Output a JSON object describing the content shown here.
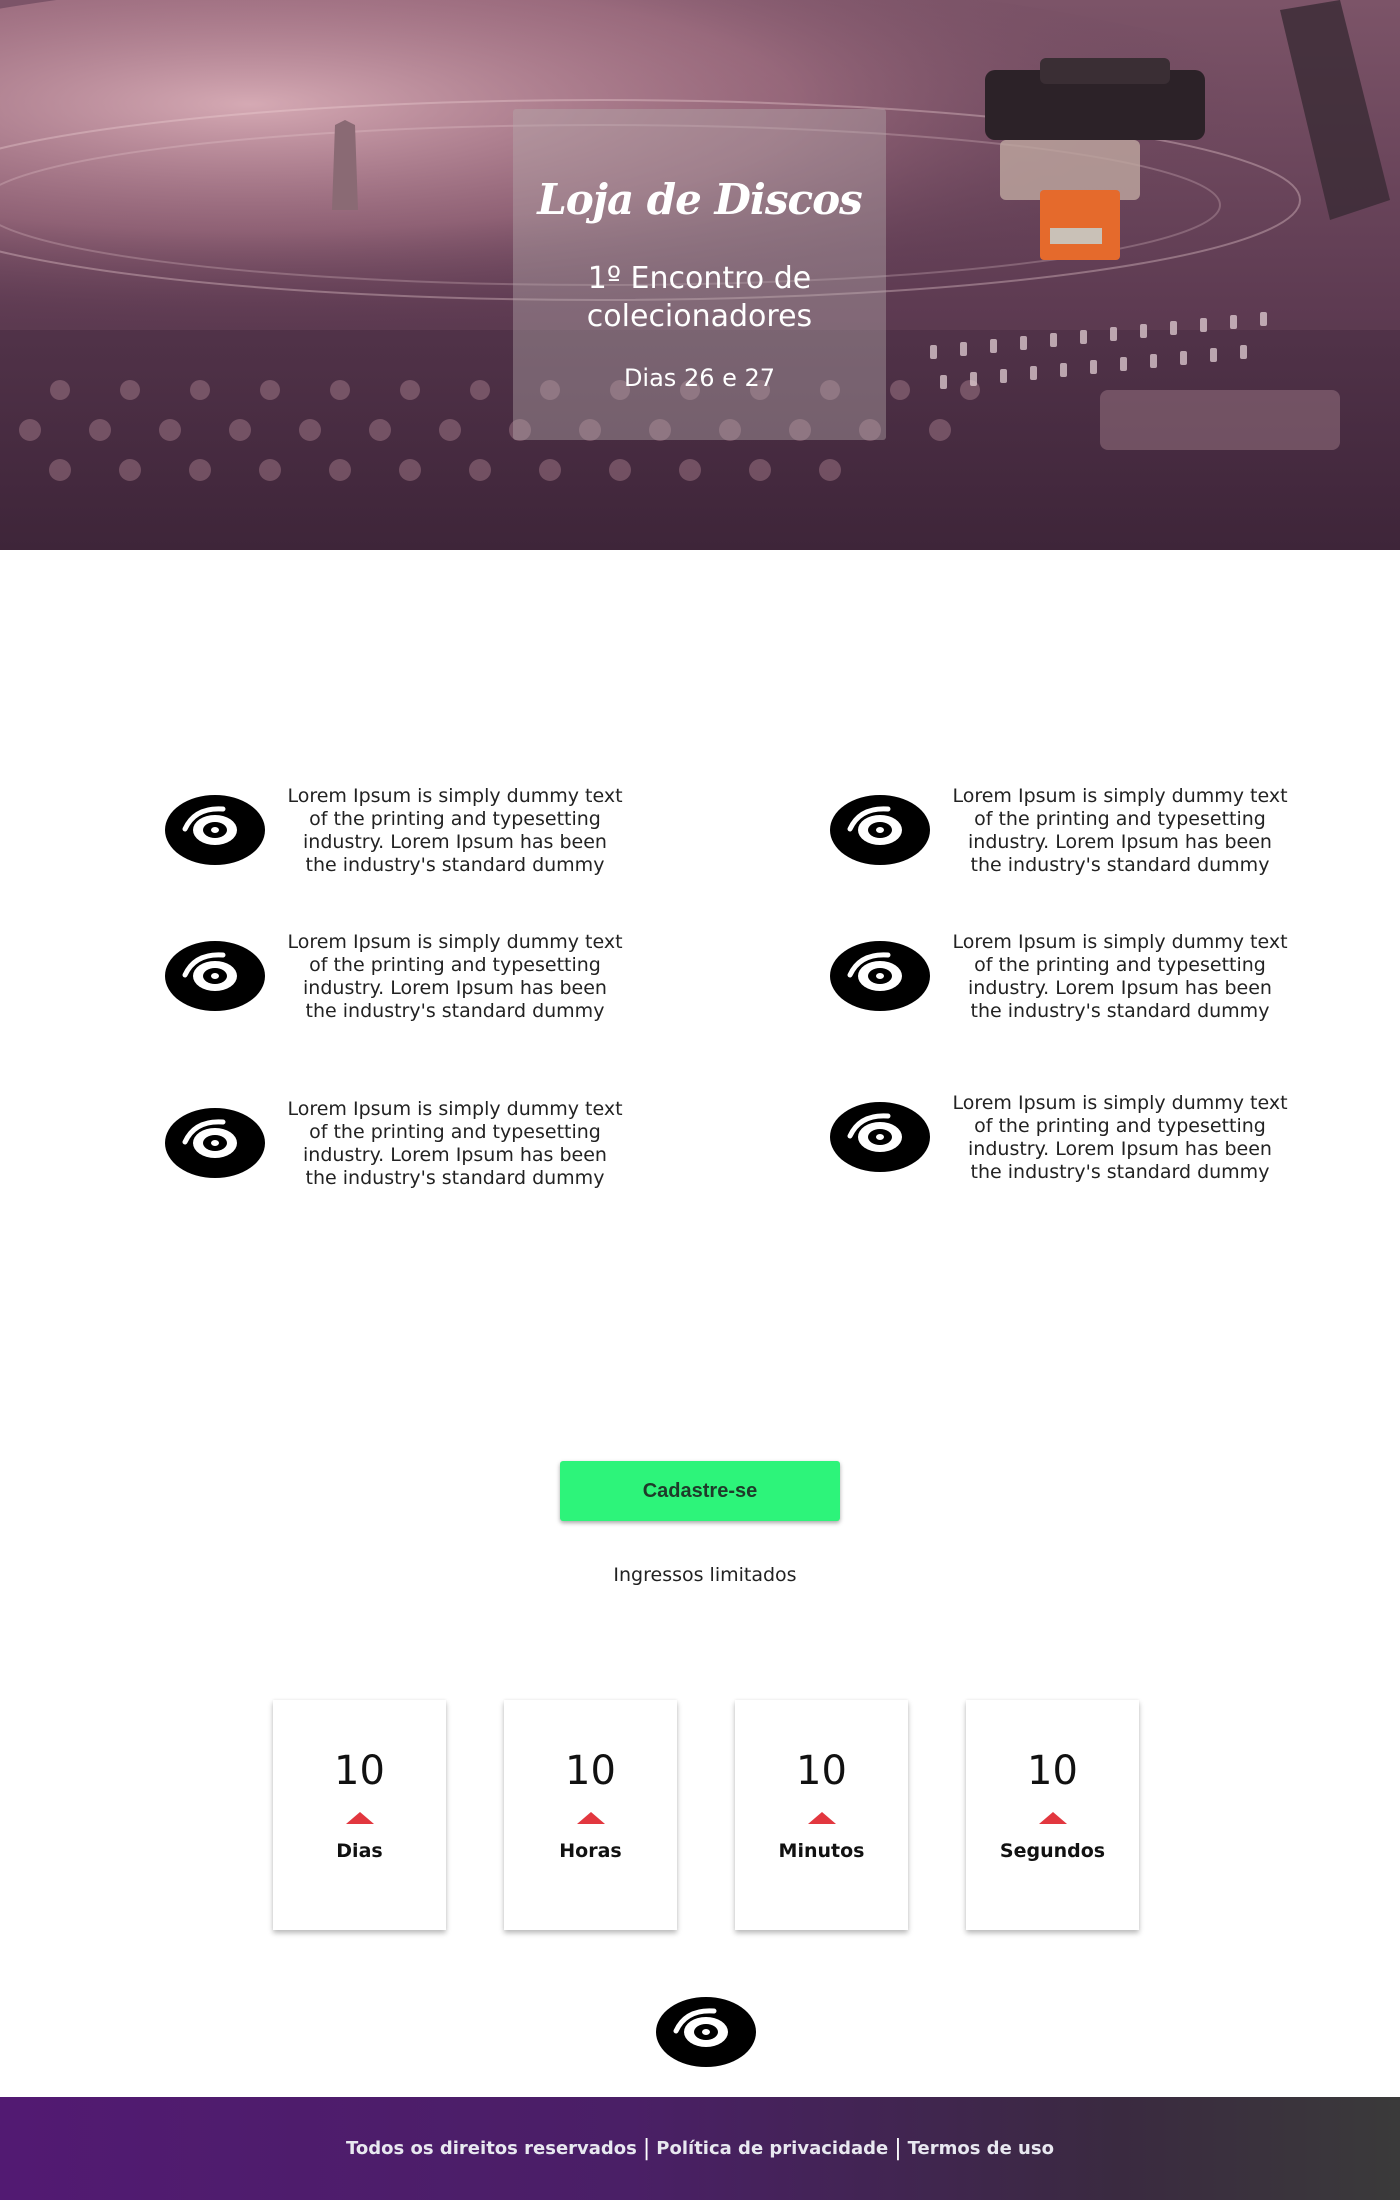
{
  "hero": {
    "title": "Loja de Discos",
    "subtitle": "1º Encontro de colecionadores",
    "dates": "Dias 26 e 27"
  },
  "features": [
    {
      "icon": "vinyl-disc-icon",
      "text": "Lorem Ipsum is simply dummy text of the printing and typesetting industry. Lorem Ipsum has been the industry's standard dummy"
    },
    {
      "icon": "vinyl-disc-icon",
      "text": "Lorem Ipsum is simply dummy text of the printing and typesetting industry. Lorem Ipsum has been the industry's standard dummy"
    },
    {
      "icon": "vinyl-disc-icon",
      "text": "Lorem Ipsum is simply dummy text of the printing and typesetting industry. Lorem Ipsum has been the industry's standard dummy"
    },
    {
      "icon": "vinyl-disc-icon",
      "text": "Lorem Ipsum is simply dummy text of the printing and typesetting industry. Lorem Ipsum has been the industry's standard dummy"
    },
    {
      "icon": "vinyl-disc-icon",
      "text": "Lorem Ipsum is simply dummy text of the printing and typesetting industry. Lorem Ipsum has been the industry's standard dummy"
    },
    {
      "icon": "vinyl-disc-icon",
      "text": "Lorem Ipsum is simply dummy text of the printing and typesetting industry. Lorem Ipsum has been the industry's standard dummy"
    }
  ],
  "cta": {
    "button_label": "Cadastre-se",
    "note": "Ingressos limitados",
    "button_color": "#2df47a"
  },
  "countdown": [
    {
      "value": "10",
      "label": "Dias"
    },
    {
      "value": "10",
      "label": "Horas"
    },
    {
      "value": "10",
      "label": "Minutos"
    },
    {
      "value": "10",
      "label": "Segundos"
    }
  ],
  "countdown_arrow_color": "#e2373f",
  "footer": {
    "rights": "Todos os direitos reservados",
    "privacy": "Política de privacidade",
    "terms": "Termos de uso",
    "separator": "|"
  }
}
